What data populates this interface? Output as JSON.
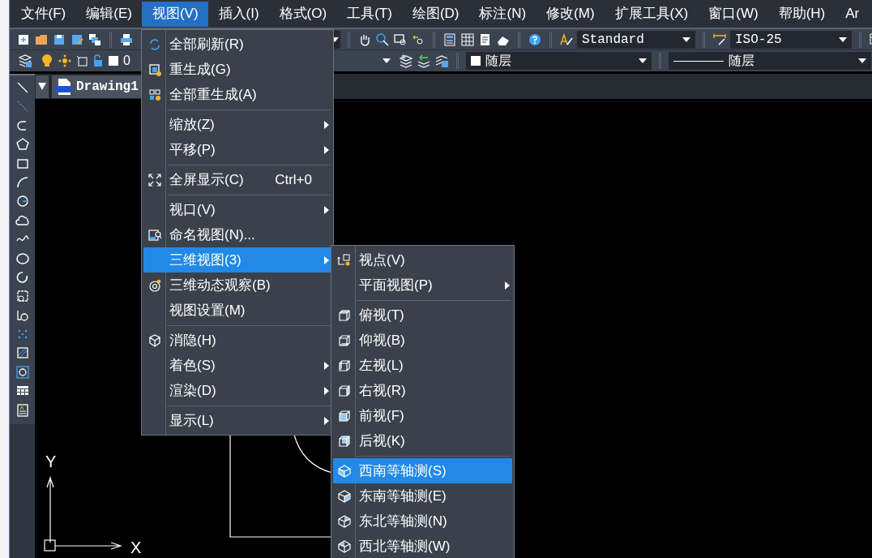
{
  "menubar": {
    "items": [
      {
        "label": "文件(F)",
        "selected": false
      },
      {
        "label": "编辑(E)",
        "selected": false
      },
      {
        "label": "视图(V)",
        "selected": true
      },
      {
        "label": "插入(I)",
        "selected": false
      },
      {
        "label": "格式(O)",
        "selected": false
      },
      {
        "label": "工具(T)",
        "selected": false
      },
      {
        "label": "绘图(D)",
        "selected": false
      },
      {
        "label": "标注(N)",
        "selected": false
      },
      {
        "label": "修改(M)",
        "selected": false
      },
      {
        "label": "扩展工具(X)",
        "selected": false
      },
      {
        "label": "窗口(W)",
        "selected": false
      },
      {
        "label": "帮助(H)",
        "selected": false
      },
      {
        "label": "Ar",
        "selected": false
      }
    ]
  },
  "toolbar": {
    "text_style": "Standard",
    "dim_style": "ISO-25",
    "layer": "0",
    "color_combo": "随层",
    "linetype": "随层"
  },
  "tabs": [
    {
      "label": "Drawing1",
      "selected": true
    }
  ],
  "canvas": {
    "y_label": "Y",
    "x_label": "X"
  },
  "view_menu": {
    "items": [
      {
        "kind": "item",
        "label": "全部刷新(R)",
        "submenu": false,
        "selected": false
      },
      {
        "kind": "item",
        "label": "重生成(G)",
        "submenu": false,
        "selected": false
      },
      {
        "kind": "item",
        "label": "全部重生成(A)",
        "submenu": false,
        "selected": false
      },
      {
        "kind": "separator"
      },
      {
        "kind": "item",
        "label": "缩放(Z)",
        "submenu": true,
        "selected": false
      },
      {
        "kind": "item",
        "label": "平移(P)",
        "submenu": true,
        "selected": false
      },
      {
        "kind": "separator"
      },
      {
        "kind": "item",
        "label": "全屏显示(C)",
        "shortcut": "Ctrl+0",
        "submenu": false,
        "selected": false
      },
      {
        "kind": "separator"
      },
      {
        "kind": "item",
        "label": "视口(V)",
        "submenu": true,
        "selected": false
      },
      {
        "kind": "item",
        "label": "命名视图(N)...",
        "submenu": false,
        "selected": false
      },
      {
        "kind": "item",
        "label": "三维视图(3)",
        "submenu": true,
        "selected": true
      },
      {
        "kind": "item",
        "label": "三维动态观察(B)",
        "submenu": false,
        "selected": false
      },
      {
        "kind": "item",
        "label": "视图设置(M)",
        "submenu": false,
        "selected": false
      },
      {
        "kind": "separator"
      },
      {
        "kind": "item",
        "label": "消隐(H)",
        "submenu": false,
        "selected": false
      },
      {
        "kind": "item",
        "label": "着色(S)",
        "submenu": true,
        "selected": false
      },
      {
        "kind": "item",
        "label": "渲染(D)",
        "submenu": true,
        "selected": false
      },
      {
        "kind": "separator"
      },
      {
        "kind": "item",
        "label": "显示(L)",
        "submenu": true,
        "selected": false
      }
    ]
  },
  "view_3d_submenu": {
    "items": [
      {
        "kind": "item",
        "label": "视点(V)",
        "submenu": false,
        "selected": false
      },
      {
        "kind": "item",
        "label": "平面视图(P)",
        "submenu": true,
        "selected": false
      },
      {
        "kind": "separator"
      },
      {
        "kind": "item",
        "label": "俯视(T)",
        "submenu": false,
        "selected": false
      },
      {
        "kind": "item",
        "label": "仰视(B)",
        "submenu": false,
        "selected": false
      },
      {
        "kind": "item",
        "label": "左视(L)",
        "submenu": false,
        "selected": false
      },
      {
        "kind": "item",
        "label": "右视(R)",
        "submenu": false,
        "selected": false
      },
      {
        "kind": "item",
        "label": "前视(F)",
        "submenu": false,
        "selected": false
      },
      {
        "kind": "item",
        "label": "后视(K)",
        "submenu": false,
        "selected": false
      },
      {
        "kind": "separator"
      },
      {
        "kind": "item",
        "label": "西南等轴测(S)",
        "submenu": false,
        "selected": true
      },
      {
        "kind": "item",
        "label": "东南等轴测(E)",
        "submenu": false,
        "selected": false
      },
      {
        "kind": "item",
        "label": "东北等轴测(N)",
        "submenu": false,
        "selected": false
      },
      {
        "kind": "item",
        "label": "西北等轴测(W)",
        "submenu": false,
        "selected": false
      }
    ]
  }
}
